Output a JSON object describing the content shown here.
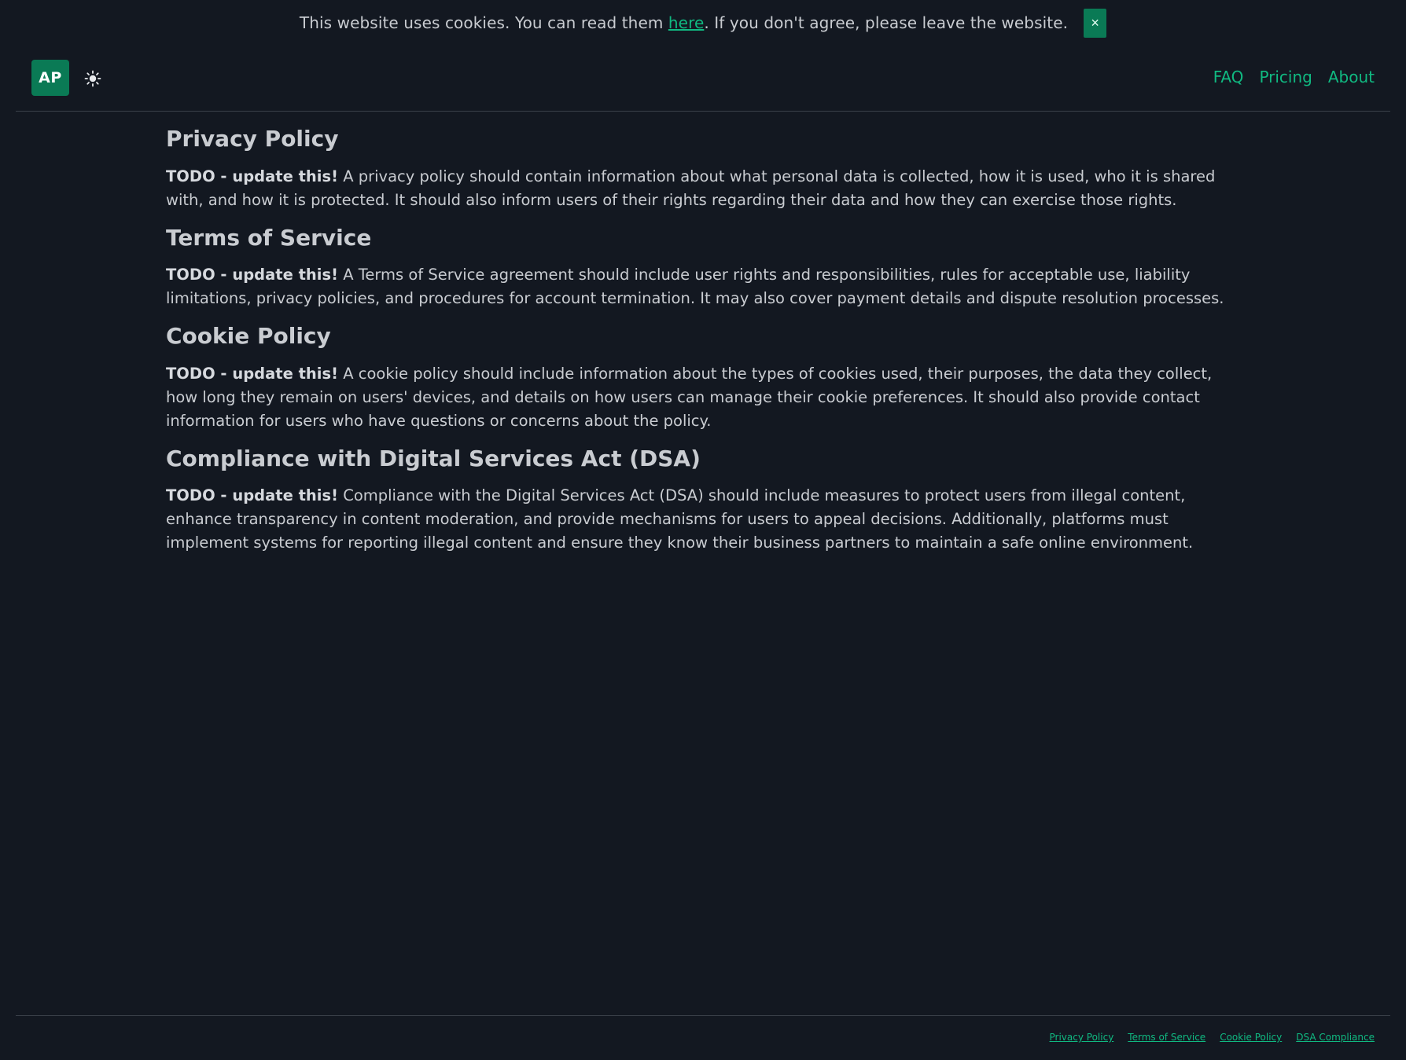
{
  "cookie_banner": {
    "text_before": "This website uses cookies. You can read them ",
    "link_label": "here",
    "text_after": ". If you don't agree, please leave the website.",
    "close_label": "×"
  },
  "header": {
    "logo_text": "AP",
    "theme_icon": "sun-icon",
    "nav": [
      {
        "label": "FAQ"
      },
      {
        "label": "Pricing"
      },
      {
        "label": "About"
      }
    ]
  },
  "sections": [
    {
      "title": "Privacy Policy",
      "lead": "TODO - update this!",
      "body": " A privacy policy should contain information about what personal data is collected, how it is used, who it is shared with, and how it is protected. It should also inform users of their rights regarding their data and how they can exercise those rights."
    },
    {
      "title": "Terms of Service",
      "lead": "TODO - update this!",
      "body": " A Terms of Service agreement should include user rights and responsibilities, rules for acceptable use, liability limitations, privacy policies, and procedures for account termination. It may also cover payment details and dispute resolution processes."
    },
    {
      "title": "Cookie Policy",
      "lead": "TODO - update this!",
      "body": " A cookie policy should include information about the types of cookies used, their purposes, the data they collect, how long they remain on users' devices, and details on how users can manage their cookie preferences. It should also provide contact information for users who have questions or concerns about the policy."
    },
    {
      "title": "Compliance with Digital Services Act (DSA)",
      "lead": "TODO - update this!",
      "body": " Compliance with the Digital Services Act (DSA) should include measures to protect users from illegal content, enhance transparency in content moderation, and provide mechanisms for users to appeal decisions. Additionally, platforms must implement systems for reporting illegal content and ensure they know their business partners to maintain a safe online environment."
    }
  ],
  "footer": {
    "links": [
      {
        "label": "Privacy Policy"
      },
      {
        "label": "Terms of Service"
      },
      {
        "label": "Cookie Policy"
      },
      {
        "label": "DSA Compliance"
      }
    ]
  },
  "colors": {
    "background": "#131821",
    "accent": "#10b981",
    "button": "#0a7a55",
    "text": "#c9ccd1"
  }
}
